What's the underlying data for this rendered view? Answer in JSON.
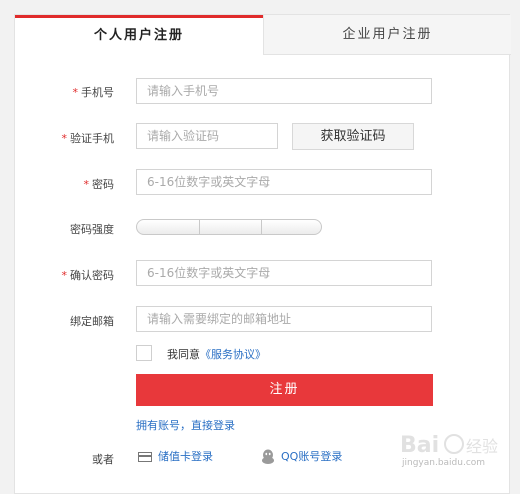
{
  "tabs": {
    "personal": "个人用户注册",
    "enterprise": "企业用户注册"
  },
  "form": {
    "required_mark": "*",
    "phone": {
      "label": "手机号",
      "placeholder": "请输入手机号"
    },
    "verify": {
      "label": "验证手机",
      "placeholder": "请输入验证码",
      "button": "获取验证码"
    },
    "password": {
      "label": "密码",
      "placeholder": "6-16位数字或英文字母"
    },
    "strength": {
      "label": "密码强度"
    },
    "confirm": {
      "label": "确认密码",
      "placeholder": "6-16位数字或英文字母"
    },
    "email": {
      "label": "绑定邮箱",
      "placeholder": "请输入需要绑定的邮箱地址"
    },
    "agree": {
      "text": "我同意",
      "link": "《服务协议》"
    },
    "submit": "注册",
    "login_link": "拥有账号，直接登录",
    "or_label": "或者",
    "card_login": "储值卡登录",
    "qq_login": "QQ账号登录"
  },
  "watermark": {
    "text": "jingyan.baidu.com"
  },
  "colors": {
    "accent": "#e8383b",
    "link": "#2a6fc4"
  }
}
